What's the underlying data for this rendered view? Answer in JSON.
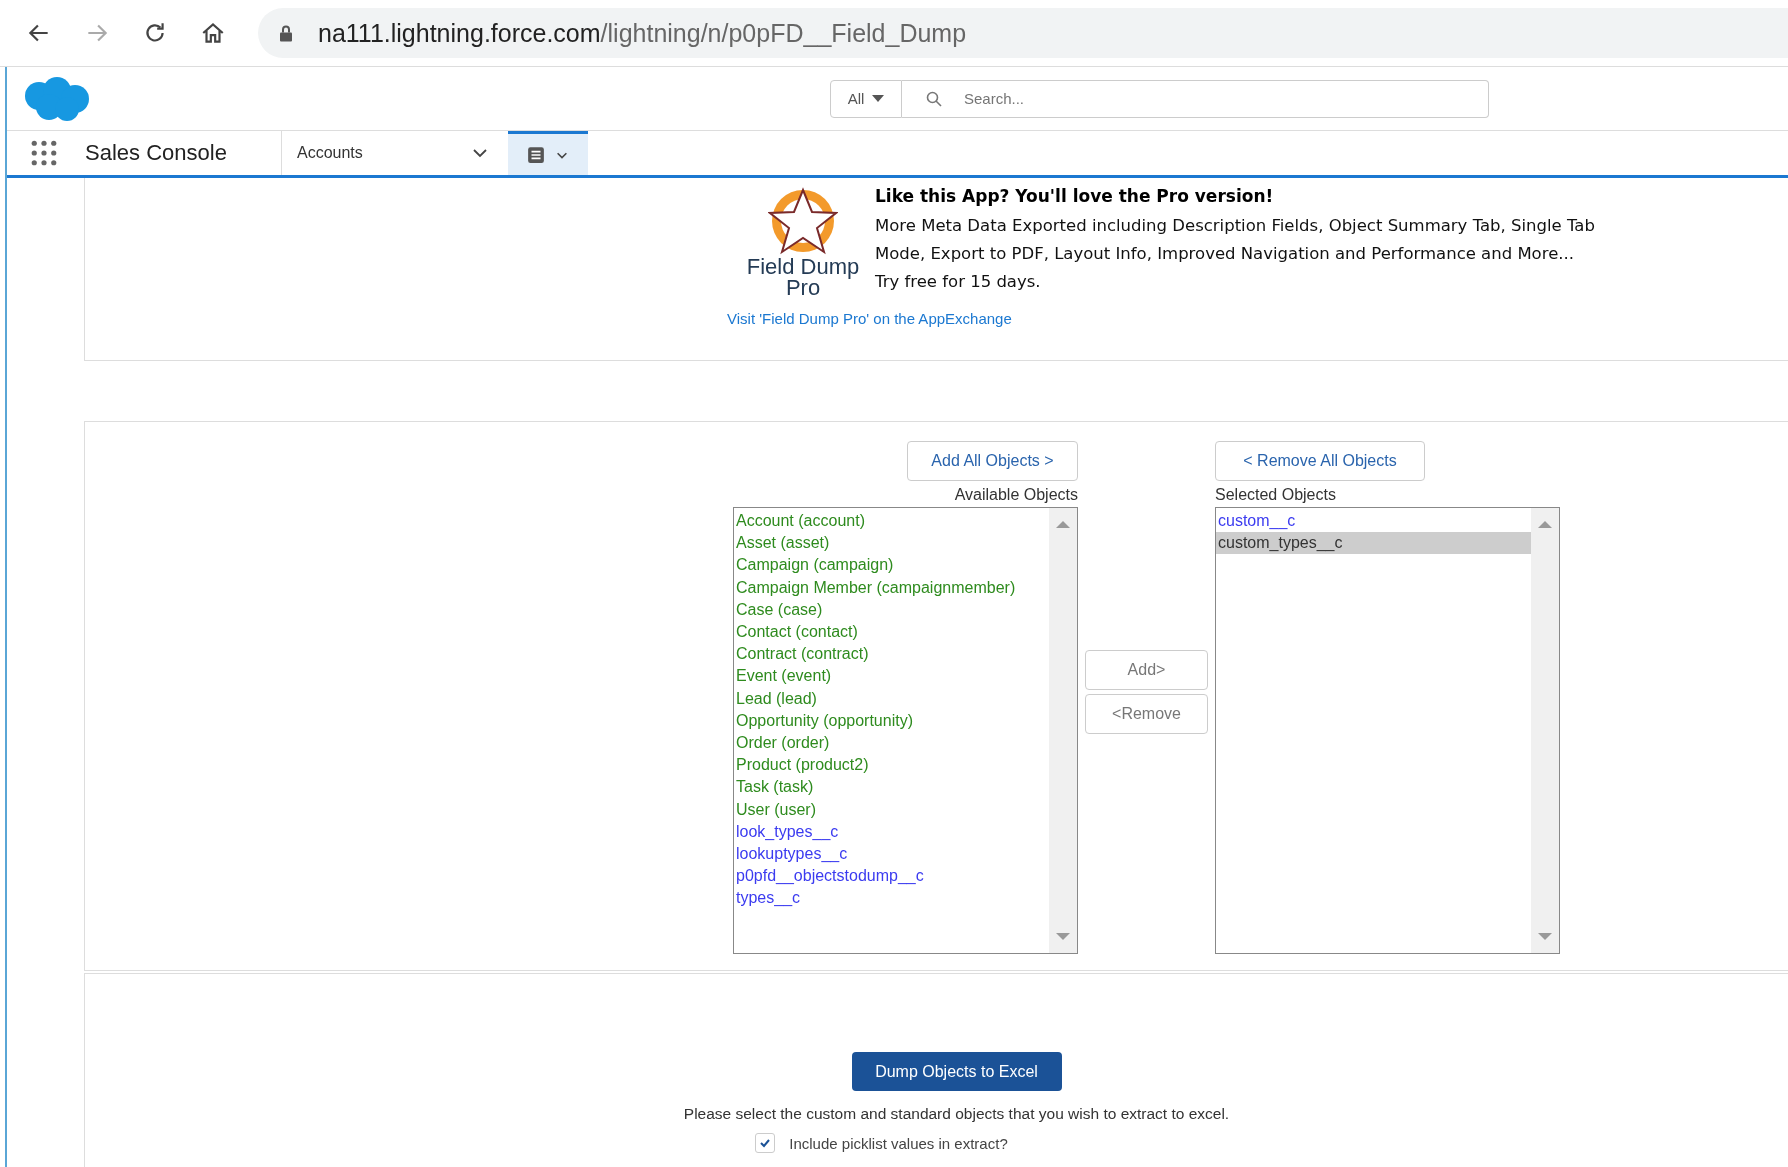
{
  "browser": {
    "url_host": "na111.lightning.force.com",
    "url_path": "/lightning/n/p0pFD__Field_Dump"
  },
  "header": {
    "scope": "All",
    "search": {
      "placeholder": "Search..."
    }
  },
  "nav": {
    "app_name": "Sales Console",
    "tab": "Accounts"
  },
  "promo": {
    "logo_text": "Field Dump Pro",
    "heading": "Like this App?  You'll love the Pro version!",
    "body": "More Meta Data Exported including Description Fields, Object Summary Tab, Single Tab Mode, Export to PDF, Layout Info, Improved Navigation and Performance and More...",
    "trial": "Try free for 15 days.",
    "link": "Visit 'Field Dump Pro' on the AppExchange"
  },
  "picker": {
    "add_all": "Add All Objects >",
    "remove_all": "< Remove All Objects",
    "available_label": "Available Objects",
    "selected_label": "Selected Objects",
    "add": "Add>",
    "remove": "<Remove",
    "available": [
      {
        "label": "Account (account)",
        "kind": "standard",
        "selected": false
      },
      {
        "label": "Asset (asset)",
        "kind": "standard",
        "selected": false
      },
      {
        "label": "Campaign (campaign)",
        "kind": "standard",
        "selected": false
      },
      {
        "label": "Campaign Member (campaignmember)",
        "kind": "standard",
        "selected": false
      },
      {
        "label": "Case (case)",
        "kind": "standard",
        "selected": false
      },
      {
        "label": "Contact (contact)",
        "kind": "standard",
        "selected": false
      },
      {
        "label": "Contract (contract)",
        "kind": "standard",
        "selected": false
      },
      {
        "label": "Event (event)",
        "kind": "standard",
        "selected": false
      },
      {
        "label": "Lead (lead)",
        "kind": "standard",
        "selected": false
      },
      {
        "label": "Opportunity (opportunity)",
        "kind": "standard",
        "selected": false
      },
      {
        "label": "Order (order)",
        "kind": "standard",
        "selected": false
      },
      {
        "label": "Product (product2)",
        "kind": "standard",
        "selected": false
      },
      {
        "label": "Task (task)",
        "kind": "standard",
        "selected": false
      },
      {
        "label": "User (user)",
        "kind": "standard",
        "selected": false
      },
      {
        "label": "look_types__c",
        "kind": "custom",
        "selected": false
      },
      {
        "label": "lookuptypes__c",
        "kind": "custom",
        "selected": false
      },
      {
        "label": "p0pfd__objectstodump__c",
        "kind": "custom",
        "selected": false
      },
      {
        "label": "types__c",
        "kind": "custom",
        "selected": false
      }
    ],
    "chosen": [
      {
        "label": "custom__c",
        "kind": "custom",
        "selected": false
      },
      {
        "label": "custom_types__c",
        "kind": "custom",
        "selected": true
      }
    ]
  },
  "export": {
    "button": "Dump Objects to Excel",
    "instructions": "Please select the custom and standard objects that you wish to extract to excel.",
    "picklist": {
      "label": "Include picklist values in extract?",
      "checked": true
    }
  }
}
